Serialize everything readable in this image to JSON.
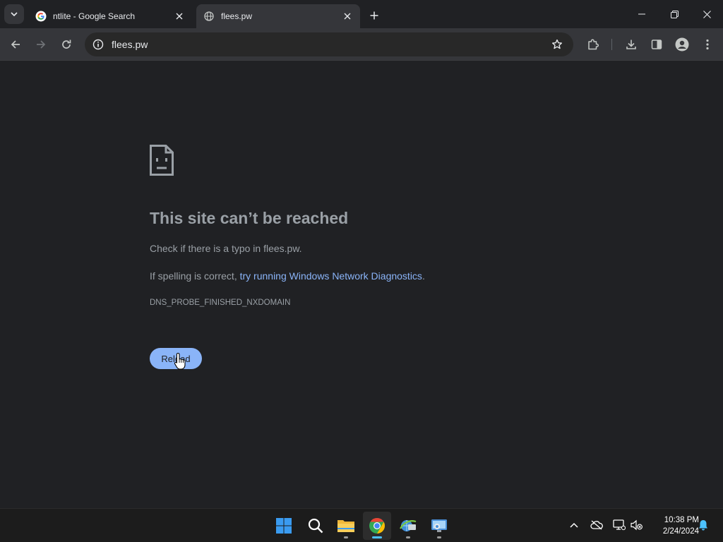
{
  "tabs": [
    {
      "title": "ntlite - Google Search",
      "favicon": "google-g-icon",
      "active": false
    },
    {
      "title": "flees.pw",
      "favicon": "globe-icon",
      "active": true
    }
  ],
  "toolbar": {
    "url": "flees.pw"
  },
  "error": {
    "title": "This site can’t be reached",
    "line1": "Check if there is a typo in flees.pw.",
    "line2_prefix": "If spelling is correct, ",
    "line2_link": "try running Windows Network Diagnostics",
    "line2_suffix": ".",
    "code": "DNS_PROBE_FINISHED_NXDOMAIN",
    "reload_label": "Reload"
  },
  "taskbar": {
    "apps": [
      "windows-start-icon",
      "search-icon",
      "file-explorer-icon",
      "chrome-icon",
      "network-app-icon",
      "remote-desktop-icon"
    ],
    "time": "10:38 PM",
    "date": "2/24/2024"
  },
  "colors": {
    "page_bg": "#202124",
    "toolbar_bg": "#35363a",
    "link": "#8ab4f8",
    "button_bg": "#8ab4f8",
    "text_muted": "#9aa0a6"
  }
}
